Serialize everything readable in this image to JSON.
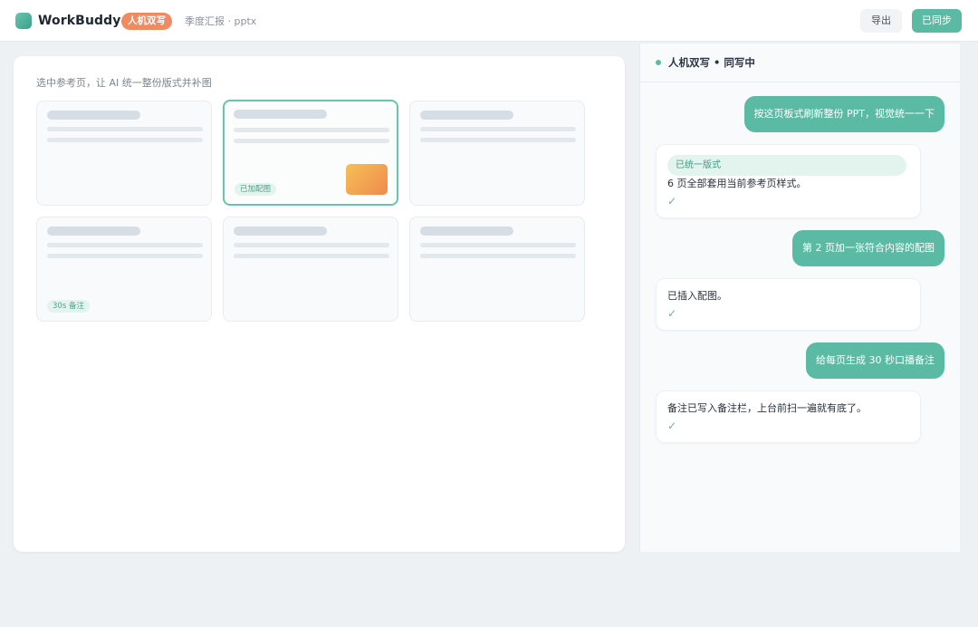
{
  "app": {
    "name": "WorkBuddy",
    "mode_badge": "人机双写",
    "file_name": "季度汇报 · pptx"
  },
  "toolbar": {
    "export_label": "导出",
    "sync_label": "已同步"
  },
  "canvas": {
    "hint": "选中参考页，让 AI 统一整份版式并补图",
    "slides": [
      {
        "chip": "",
        "has_image": false,
        "selected": false
      },
      {
        "chip": "已加配图",
        "has_image": true,
        "selected": true
      },
      {
        "chip": "",
        "has_image": false,
        "selected": false
      },
      {
        "chip": "30s 备注",
        "has_image": false,
        "selected": false
      },
      {
        "chip": "",
        "has_image": false,
        "selected": false
      },
      {
        "chip": "",
        "has_image": false,
        "selected": false
      }
    ]
  },
  "chat": {
    "title": "人机双写 • 同写中",
    "messages": [
      {
        "role": "user",
        "text": "按这页板式刷新整份 PPT，视觉统一一下"
      },
      {
        "role": "ai",
        "tag": "已统一版式",
        "text": "6 页全部套用当前参考页样式。",
        "check": "✓"
      },
      {
        "role": "user",
        "text": "第 2 页加一张符合内容的配图"
      },
      {
        "role": "ai",
        "text": "已插入配图。",
        "check": "✓"
      },
      {
        "role": "user",
        "text": "给每页生成 30 秒口播备注"
      },
      {
        "role": "ai",
        "text": "备注已写入备注栏，上台前扫一遍就有底了。",
        "check": "✓"
      }
    ]
  },
  "colors": {
    "accent": "#5bbaa4",
    "badge": "#f08a63",
    "image_gradient_start": "#f6c055",
    "image_gradient_end": "#ef8a4e"
  }
}
